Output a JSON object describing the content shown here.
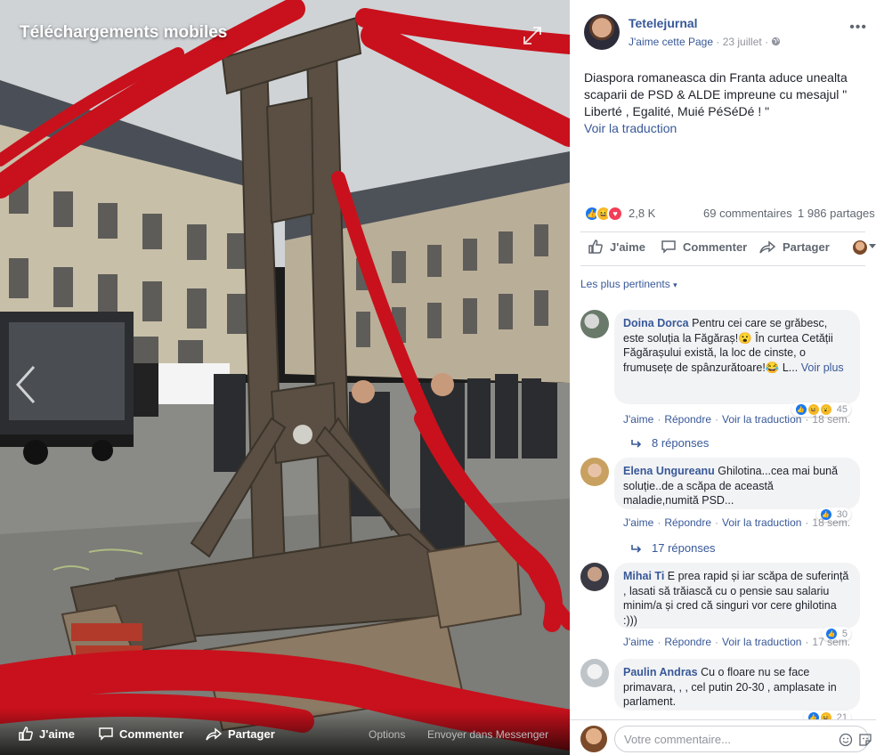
{
  "media": {
    "title": "Téléchargements mobiles",
    "bottom_bar": {
      "like_label": "J'aime",
      "comment_label": "Commenter",
      "share_label": "Partager",
      "options_label": "Options",
      "messenger_label": "Envoyer dans Messenger"
    }
  },
  "post": {
    "page_name": "Tetelejurnal",
    "like_page_label": "J'aime cette Page",
    "date": "23 juillet",
    "text": "Diaspora romaneasca din Franta aduce unealta scaparii de PSD & ALDE impreune cu mesajul \" Liberté , Egalité, Muié PéSéDé ! \"",
    "see_translation": "Voir la traduction",
    "reactions_count": "2,8 K",
    "comments_count": "69 commentaires",
    "shares_count": "1 986 partages",
    "actions": {
      "like": "J'aime",
      "comment": "Commenter",
      "share": "Partager"
    },
    "sort_label": "Les plus pertinents"
  },
  "colors": {
    "link": "#385898",
    "like_blue": "#1877f2",
    "love_red": "#f33e58",
    "haha_yellow": "#f7b928"
  },
  "comments": [
    {
      "author": "Doina Dorca",
      "text": " Pentru cei care se grăbesc, este soluția la Făgăraș!😮 În curtea Cetății Făgărașului există, la loc de cinste, o frumusețe de spânzurătoare!😂 L...",
      "see_more": "Voir plus",
      "like": "J'aime",
      "reply": "Répondre",
      "translate": "Voir la traduction",
      "time": "18 sem.",
      "reactions_count": "45",
      "replies": "8 réponses"
    },
    {
      "author": "Elena Ungureanu",
      "text": " Ghilotina...cea mai bună soluție..de a scăpa de această maladie,numită PSD...",
      "like": "J'aime",
      "reply": "Répondre",
      "translate": "Voir la traduction",
      "time": "18 sem.",
      "reactions_count": "30",
      "replies": "17 réponses"
    },
    {
      "author": "Mihai Ti",
      "text": " E prea rapid și iar scăpa de suferință , lasati să trăiască cu o pensie sau salariu minim/a și cred că singuri vor cere ghilotina :)))",
      "like": "J'aime",
      "reply": "Répondre",
      "translate": "Voir la traduction",
      "time": "17 sem.",
      "reactions_count": "5"
    },
    {
      "author": "Paulin Andras",
      "text": " Cu o floare nu se face primavara, , , cel putin 20-30 , amplasate in parlament.",
      "reactions_count": "21"
    }
  ],
  "compose": {
    "placeholder": "Votre commentaire..."
  }
}
